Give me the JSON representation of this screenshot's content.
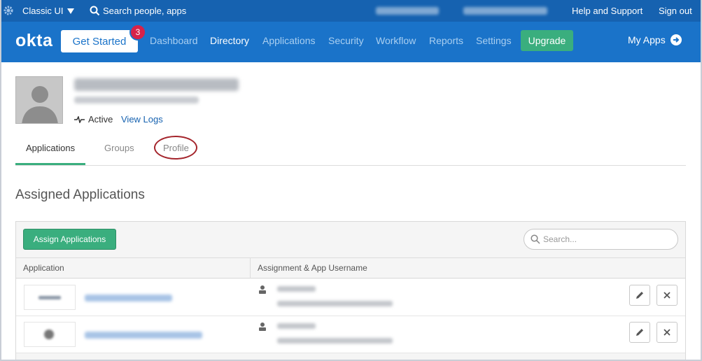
{
  "topbar": {
    "ui_mode": "Classic UI",
    "search_label": "Search people, apps",
    "help": "Help and Support",
    "signout": "Sign out"
  },
  "nav": {
    "logo": "okta",
    "get_started": "Get Started",
    "badge_count": "3",
    "links": [
      "Dashboard",
      "Directory",
      "Applications",
      "Security",
      "Workflow",
      "Reports",
      "Settings"
    ],
    "active": "Directory",
    "upgrade": "Upgrade",
    "my_apps": "My Apps"
  },
  "profile": {
    "status": "Active",
    "view_logs": "View Logs"
  },
  "tabs": [
    "Applications",
    "Groups",
    "Profile"
  ],
  "section_title": "Assigned Applications",
  "assign_button": "Assign Applications",
  "search": {
    "placeholder": "Search..."
  },
  "table": {
    "columns": [
      "Application",
      "Assignment & App Username"
    ]
  },
  "colors": {
    "topbar": "#1662b0",
    "navbar": "#1a73c9",
    "accent_green": "#3aae7e",
    "badge_red": "#d62249",
    "annotation_circle": "#a4242b"
  },
  "icons": [
    "gear-icon",
    "caret-down-icon",
    "search-icon",
    "arrow-right-circle-icon",
    "avatar-placeholder-icon",
    "activity-pulse-icon",
    "user-icon",
    "pencil-icon",
    "close-icon"
  ]
}
